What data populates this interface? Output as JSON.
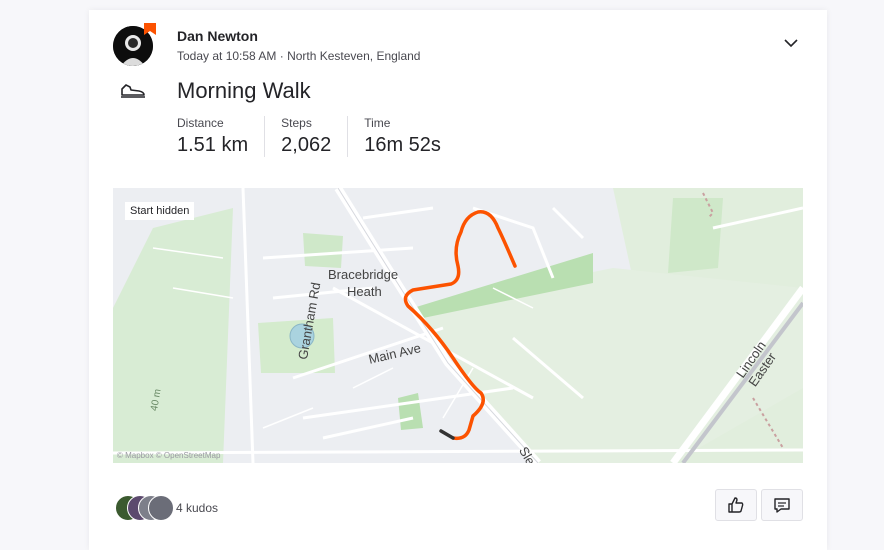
{
  "athlete": {
    "name": "Dan Newton",
    "meta": "Today at 10:58 AM · North Kesteven, England"
  },
  "activity": {
    "title": "Morning Walk",
    "sport_icon": "shoe-icon",
    "stats": [
      {
        "label": "Distance",
        "value": "1.51 km"
      },
      {
        "label": "Steps",
        "value": "2,062"
      },
      {
        "label": "Time",
        "value": "16m 52s"
      }
    ]
  },
  "map": {
    "start_hidden": "Start hidden",
    "labels": {
      "place": "Bracebridge",
      "place2": "Heath",
      "road_main": "Main Ave",
      "road_grantham": "Grantham Rd",
      "road_lincoln": "Lincoln Easter",
      "road_sle": "Sle",
      "elevation": "40 m"
    },
    "attribution": "© Mapbox © OpenStreetMap",
    "route_color": "#fc5200"
  },
  "kudos": {
    "count_label": "4 kudos"
  },
  "icons": {
    "menu": "chevron-down-icon",
    "kudos": "thumbs-up-icon",
    "comment": "comment-icon"
  }
}
